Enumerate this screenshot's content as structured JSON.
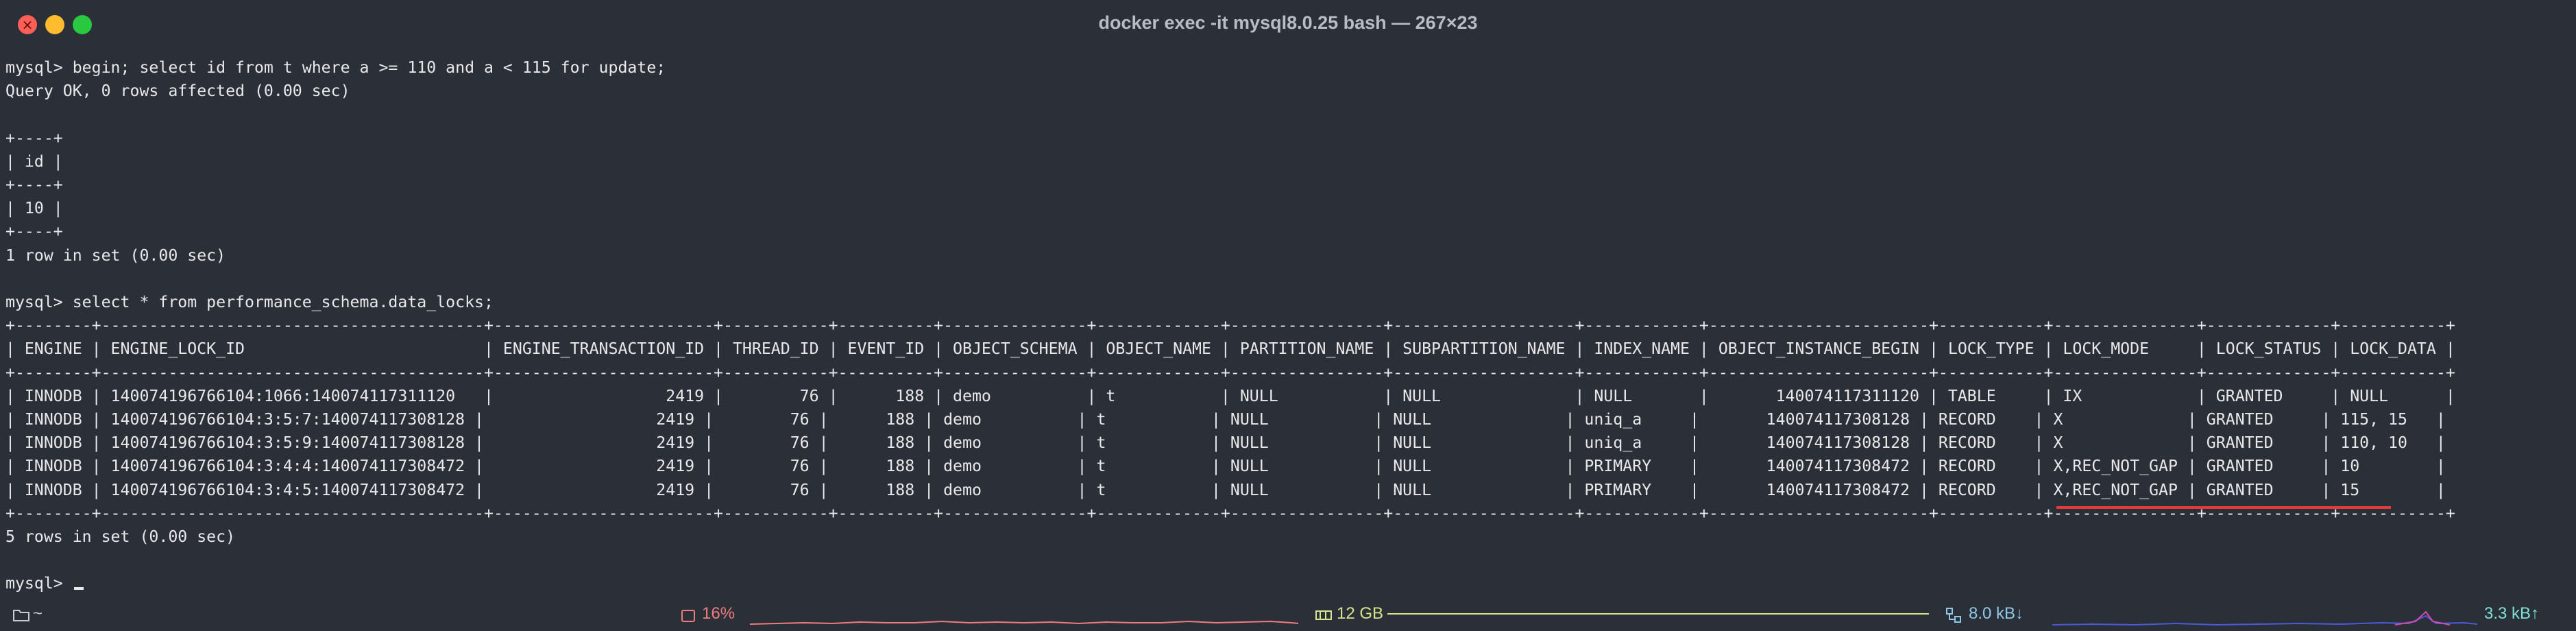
{
  "window": {
    "title": "docker exec -it mysql8.0.25 bash — 267×23"
  },
  "terminal": {
    "lines": [
      "mysql> begin; select id from t where a >= 110 and a < 115 for update;",
      "Query OK, 0 rows affected (0.00 sec)",
      "",
      "+----+",
      "| id |",
      "+----+",
      "| 10 |",
      "+----+",
      "1 row in set (0.00 sec)",
      "",
      "mysql> select * from performance_schema.data_locks;",
      "+--------+----------------------------------------+-----------------------+-----------+----------+---------------+-------------+----------------+-------------------+------------+-----------------------+-----------+---------------+-------------+-----------+",
      "| ENGINE | ENGINE_LOCK_ID                         | ENGINE_TRANSACTION_ID | THREAD_ID | EVENT_ID | OBJECT_SCHEMA | OBJECT_NAME | PARTITION_NAME | SUBPARTITION_NAME | INDEX_NAME | OBJECT_INSTANCE_BEGIN | LOCK_TYPE | LOCK_MODE     | LOCK_STATUS | LOCK_DATA |",
      "+--------+----------------------------------------+-----------------------+-----------+----------+---------------+-------------+----------------+-------------------+------------+-----------------------+-----------+---------------+-------------+-----------+",
      "| INNODB | 140074196766104:1066:140074117311120   |                  2419 |        76 |      188 | demo          | t           | NULL           | NULL              | NULL       |       140074117311120 | TABLE     | IX            | GRANTED     | NULL      |",
      "| INNODB | 140074196766104:3:5:7:140074117308128 |                  2419 |        76 |      188 | demo          | t           | NULL           | NULL              | uniq_a     |       140074117308128 | RECORD    | X             | GRANTED     | 115, 15   |",
      "| INNODB | 140074196766104:3:5:9:140074117308128 |                  2419 |        76 |      188 | demo          | t           | NULL           | NULL              | uniq_a     |       140074117308128 | RECORD    | X             | GRANTED     | 110, 10   |",
      "| INNODB | 140074196766104:3:4:4:140074117308472 |                  2419 |        76 |      188 | demo          | t           | NULL           | NULL              | PRIMARY    |       140074117308472 | RECORD    | X,REC_NOT_GAP | GRANTED     | 10        |",
      "| INNODB | 140074196766104:3:4:5:140074117308472 |                  2419 |        76 |      188 | demo          | t           | NULL           | NULL              | PRIMARY    |       140074117308472 | RECORD    | X,REC_NOT_GAP | GRANTED     | 15        |",
      "+--------+----------------------------------------+-----------------------+-----------+----------+---------------+-------------+----------------+-------------------+------------+-----------------------+-----------+---------------+-------------+-----------+",
      "5 rows in set (0.00 sec)",
      "",
      "mysql> "
    ]
  },
  "statusbar": {
    "cwd": "~",
    "cpu": "16%",
    "memory": "12 GB",
    "net_down": "8.0 kB↓",
    "net_up": "3.3 kB↑",
    "icons": [
      "folder-icon",
      "cpu-icon",
      "memory-icon",
      "network-icon"
    ],
    "colors": {
      "cpu": "#f07d7d",
      "memory": "#d6e58a",
      "net_down": "#8fc8e8",
      "net_up": "#7ee0d6"
    }
  },
  "colors": {
    "background": "#2b2f38",
    "text": "#e8e8ea",
    "highlight_underline": "#e23b3b"
  }
}
